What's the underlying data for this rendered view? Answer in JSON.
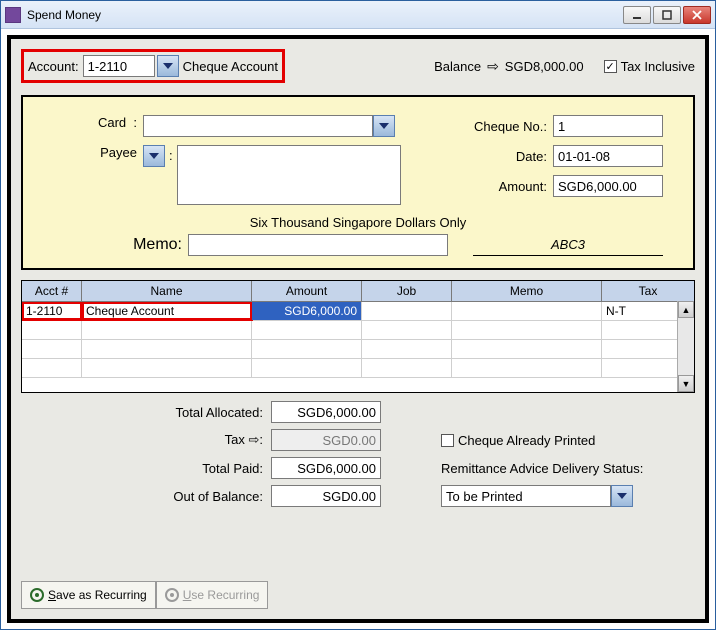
{
  "window": {
    "title": "Spend Money"
  },
  "top": {
    "account_label": "Account:",
    "account_value": "1-2110",
    "account_name": "Cheque Account",
    "balance_label": "Balance",
    "balance_value": "SGD8,000.00",
    "tax_inclusive_label": "Tax Inclusive",
    "tax_inclusive_checked": "✓"
  },
  "cheque": {
    "card_label": "Card",
    "card_value": "",
    "payee_label": "Payee",
    "payee_value": "",
    "cheque_no_label": "Cheque No.:",
    "cheque_no_value": "1",
    "date_label": "Date:",
    "date_value": "01-01-08",
    "amount_label": "Amount:",
    "amount_value": "SGD6,000.00",
    "amount_words": "Six Thousand Singapore Dollars Only",
    "memo_label": "Memo:",
    "memo_value": "",
    "ref": "ABC3"
  },
  "table": {
    "headers": {
      "acct": "Acct #",
      "name": "Name",
      "amount": "Amount",
      "job": "Job",
      "memo": "Memo",
      "tax": "Tax"
    },
    "rows": [
      {
        "acct": "1-2110",
        "name": "Cheque Account",
        "amount": "SGD6,000.00",
        "job": "",
        "memo": "",
        "tax": "N-T"
      }
    ]
  },
  "totals": {
    "total_allocated_label": "Total Allocated:",
    "total_allocated_value": "SGD6,000.00",
    "tax_label": "Tax",
    "tax_value": "SGD0.00",
    "total_paid_label": "Total Paid:",
    "total_paid_value": "SGD6,000.00",
    "out_of_balance_label": "Out of Balance:",
    "out_of_balance_value": "SGD0.00",
    "cheque_printed_label": "Cheque Already Printed",
    "remittance_label": "Remittance Advice Delivery Status:",
    "remittance_value": "To be Printed"
  },
  "buttons": {
    "save_recurring": "Save as Recurring",
    "use_recurring": "Use Recurring"
  }
}
